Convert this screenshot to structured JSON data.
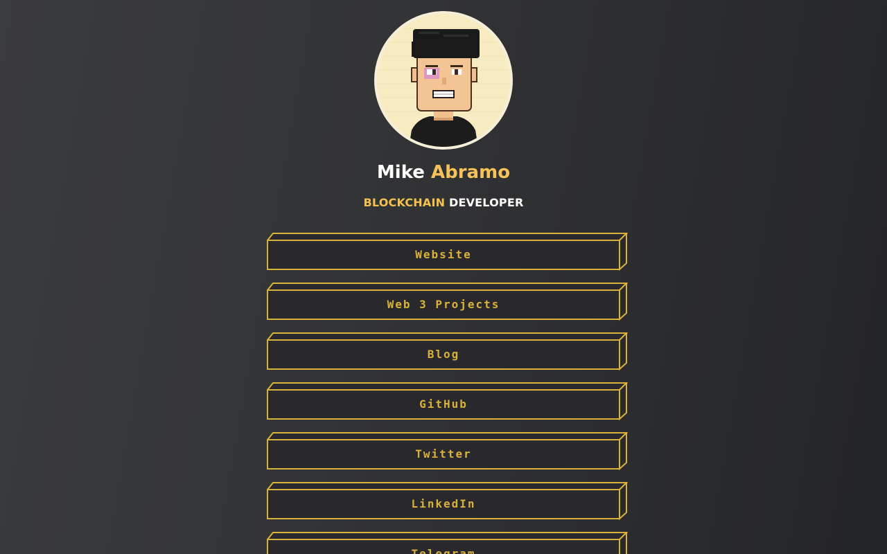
{
  "profile": {
    "first_name": "Mike",
    "last_name": "Abramo",
    "role_highlight": "BLOCKCHAIN",
    "role_rest": "DEVELOPER",
    "avatar_icon": "pixel-avatar-icon"
  },
  "links": [
    {
      "label": "Website"
    },
    {
      "label": "Web 3 Projects"
    },
    {
      "label": "Blog"
    },
    {
      "label": "GitHub"
    },
    {
      "label": "Twitter"
    },
    {
      "label": "LinkedIn"
    },
    {
      "label": "Telegram"
    }
  ],
  "colors": {
    "accent": "#f7c25a",
    "button_border": "#d9b23a",
    "button_face": "#29292d",
    "text": "#ffffff"
  }
}
